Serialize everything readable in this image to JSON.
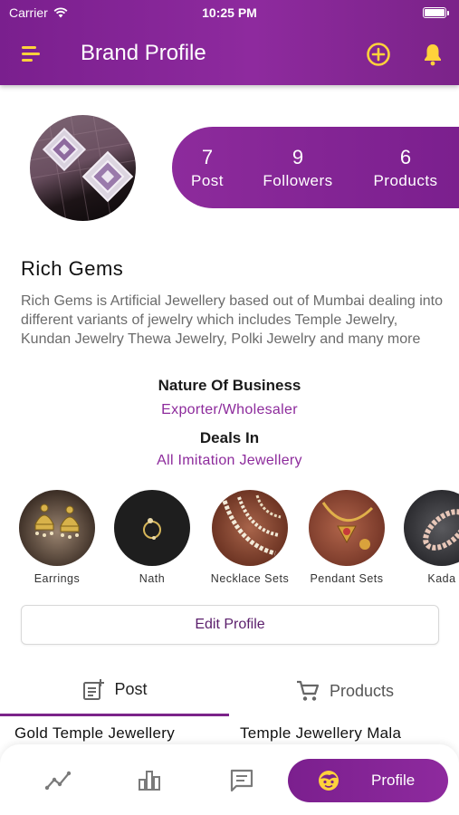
{
  "status_bar": {
    "carrier": "Carrier",
    "time": "10:25 PM"
  },
  "header": {
    "title": "Brand Profile"
  },
  "colors": {
    "accent": "#7b2389",
    "accent_light": "#8d2b9c",
    "icon_yellow": "#ffd23b"
  },
  "stats": [
    {
      "value": "7",
      "label": "Post"
    },
    {
      "value": "9",
      "label": "Followers"
    },
    {
      "value": "6",
      "label": "Products"
    }
  ],
  "profile": {
    "name": "Rich Gems",
    "description": "Rich Gems is Artificial Jewellery based out of  Mumbai dealing into different variants of jewelry which includes Temple Jewelry, Kundan Jewelry Thewa Jewelry, Polki Jewelry and many more",
    "nature_label": "Nature Of Business",
    "nature_value": "Exporter/Wholesaler",
    "deals_label": "Deals In",
    "deals_value": "All Imitation Jewellery"
  },
  "categories": [
    {
      "label": "Earrings"
    },
    {
      "label": "Nath"
    },
    {
      "label": "Necklace Sets"
    },
    {
      "label": "Pendant Sets"
    },
    {
      "label": "Kada"
    }
  ],
  "edit_button": "Edit Profile",
  "tabs": [
    {
      "label": "Post",
      "icon": "post-add-icon"
    },
    {
      "label": "Products",
      "icon": "cart-icon"
    }
  ],
  "tiles": [
    {
      "title": "Gold Temple Jewellery"
    },
    {
      "title": "Temple Jewellery Mala"
    }
  ],
  "bottom_nav": {
    "items": [
      {
        "icon": "insights-icon"
      },
      {
        "icon": "bar-chart-icon"
      },
      {
        "icon": "message-icon"
      }
    ],
    "active": {
      "icon": "face-icon",
      "label": "Profile"
    }
  }
}
